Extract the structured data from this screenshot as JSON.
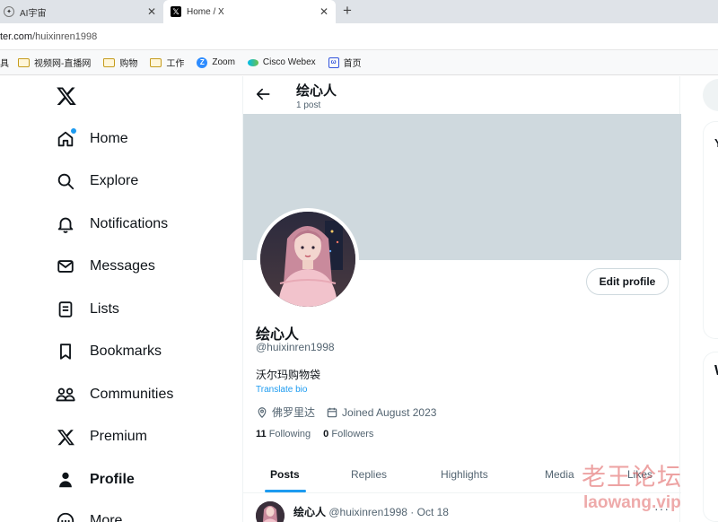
{
  "browser": {
    "tabs": [
      {
        "title": "AI宇宙",
        "active": false
      },
      {
        "title": "Home / X",
        "active": true
      }
    ],
    "url_prefix": "ter.com",
    "url_path": "/huixinren1998",
    "bookmarks": [
      {
        "label": "具",
        "icon": "none"
      },
      {
        "label": "视频网-直播网",
        "icon": "folder-icon"
      },
      {
        "label": "购物",
        "icon": "folder-icon"
      },
      {
        "label": "工作",
        "icon": "folder-icon"
      },
      {
        "label": "Zoom",
        "icon": "zoom-icon"
      },
      {
        "label": "Cisco Webex",
        "icon": "webex-icon"
      },
      {
        "label": "首页",
        "icon": "home-bookmark-icon"
      }
    ]
  },
  "sidebar": {
    "items": [
      {
        "label": "Home",
        "icon": "home-icon"
      },
      {
        "label": "Explore",
        "icon": "search-icon"
      },
      {
        "label": "Notifications",
        "icon": "bell-icon"
      },
      {
        "label": "Messages",
        "icon": "envelope-icon"
      },
      {
        "label": "Lists",
        "icon": "list-icon"
      },
      {
        "label": "Bookmarks",
        "icon": "bookmark-icon"
      },
      {
        "label": "Communities",
        "icon": "people-icon"
      },
      {
        "label": "Premium",
        "icon": "x-logo-icon"
      },
      {
        "label": "Profile",
        "icon": "person-icon",
        "active": true
      },
      {
        "label": "More",
        "icon": "more-circle-icon"
      }
    ]
  },
  "header": {
    "title": "绘心人",
    "subtitle": "1 post"
  },
  "profile": {
    "display_name": "绘心人",
    "handle": "@huixinren1998",
    "bio": "沃尔玛购物袋",
    "translate_label": "Translate bio",
    "location": "佛罗里达",
    "joined": "Joined August 2023",
    "following_count": "11",
    "following_label": "Following",
    "followers_count": "0",
    "followers_label": "Followers",
    "edit_label": "Edit profile"
  },
  "profile_tabs": [
    {
      "label": "Posts",
      "active": true
    },
    {
      "label": "Replies"
    },
    {
      "label": "Highlights"
    },
    {
      "label": "Media"
    },
    {
      "label": "Likes"
    }
  ],
  "post": {
    "name": "绘心人",
    "handle": "@huixinren1998",
    "separator": "·",
    "date": "Oct 18",
    "more": "···"
  },
  "right_cards": {
    "card1_initial": "Y",
    "card2_initial": "W"
  },
  "watermark": {
    "cn": "老王论坛",
    "en": "laowang.vip"
  },
  "colors": {
    "accent": "#1d9bf0",
    "banner": "#cfd9de",
    "text": "#0f1419",
    "muted": "#536471"
  }
}
